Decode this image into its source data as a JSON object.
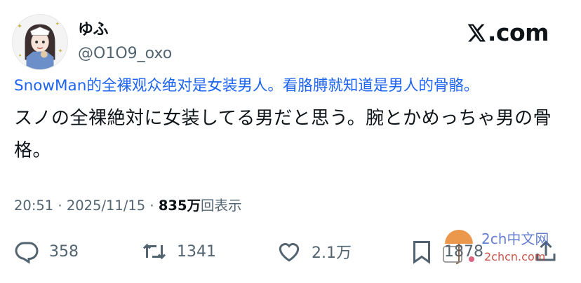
{
  "author": {
    "display_name": "ゆふ",
    "handle": "@O1O9_oxo"
  },
  "brand": {
    "label": ".com",
    "icon": "x-logo-icon"
  },
  "post": {
    "translation": "SnowMan的全裸观众绝对是女装男人。看胳膊就知道是男人的骨骼。",
    "text": "スノの全裸絶対に女装してる男だと思う。腕とかめっちゃ男の骨格。"
  },
  "meta": {
    "time": "20:51",
    "sep1": "·",
    "date": "2025/11/15",
    "sep2": "·",
    "views_count": "835万",
    "views_label": "回表示"
  },
  "actions": {
    "replies": "358",
    "retweets": "1341",
    "likes": "2.1万",
    "bookmarks": "1878"
  },
  "watermark": {
    "line1": "2ch中文网",
    "line2": "2chcn.com"
  },
  "colors": {
    "text": "#0f1419",
    "secondary": "#536471",
    "translation": "#1d64f0"
  }
}
